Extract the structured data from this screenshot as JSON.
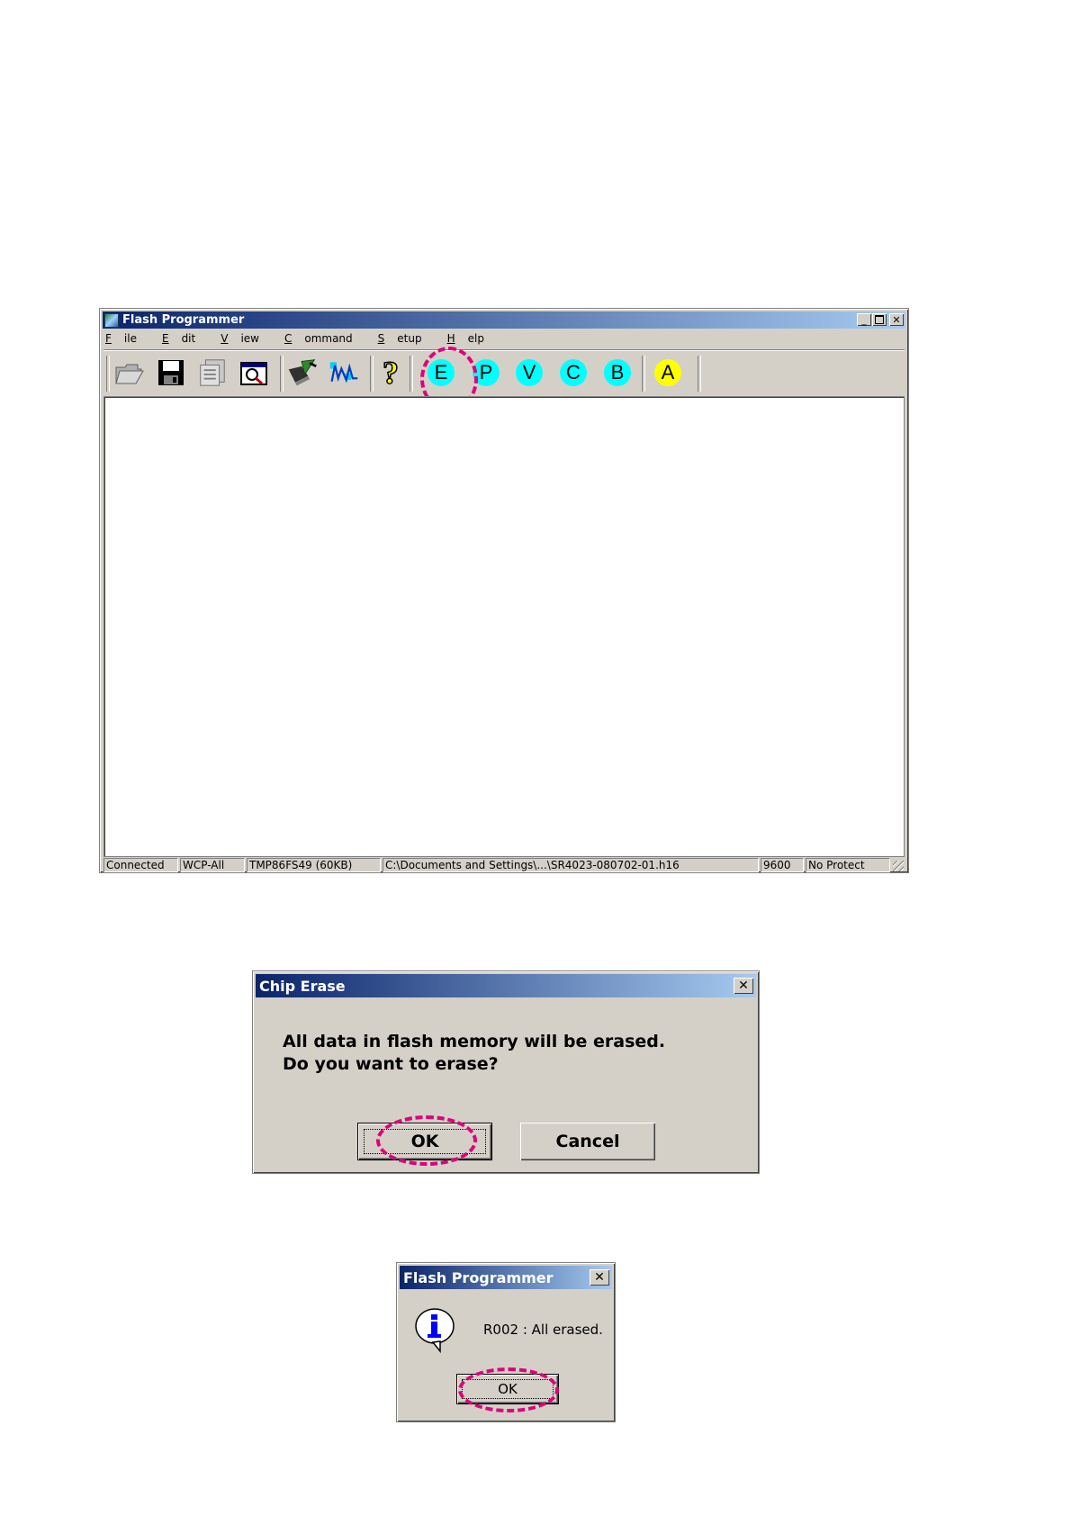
{
  "main_window": {
    "title": "Flash Programmer",
    "menu": [
      {
        "hot": "F",
        "rest": "ile"
      },
      {
        "hot": "E",
        "rest": "dit"
      },
      {
        "hot": "V",
        "rest": "iew"
      },
      {
        "hot": "C",
        "rest": "ommand"
      },
      {
        "hot": "S",
        "rest": "etup"
      },
      {
        "hot": "H",
        "rest": "elp"
      }
    ],
    "toolbar_icons": [
      "open-folder-icon",
      "save-disk-icon",
      "properties-icon",
      "search-window-icon",
      "write-device-icon",
      "waveform-icon",
      "help-icon"
    ],
    "command_buttons": [
      {
        "label": "E",
        "color": "#00ffff"
      },
      {
        "label": "P",
        "color": "#00ffff"
      },
      {
        "label": "V",
        "color": "#00ffff"
      },
      {
        "label": "C",
        "color": "#00ffff"
      },
      {
        "label": "B",
        "color": "#00ffff"
      },
      {
        "label": "A",
        "color": "#ffff00"
      }
    ],
    "status": {
      "connection": "Connected",
      "target": "WCP-All",
      "device": "TMP86FS49 (60KB)",
      "file": "C:\\Documents and Settings\\...\\SR4023-080702-01.h16",
      "baud": "9600",
      "protect": "No Protect"
    }
  },
  "erase_dialog": {
    "title": "Chip Erase",
    "line1": "All data in flash memory will be erased.",
    "line2": "Do you want to erase?",
    "ok": "OK",
    "cancel": "Cancel"
  },
  "result_dialog": {
    "title": "Flash Programmer",
    "message": "R002 : All erased.",
    "ok": "OK"
  },
  "colors": {
    "highlight": "#e0007a",
    "titlebar_start": "#0a246a",
    "titlebar_end": "#a6caf0"
  }
}
